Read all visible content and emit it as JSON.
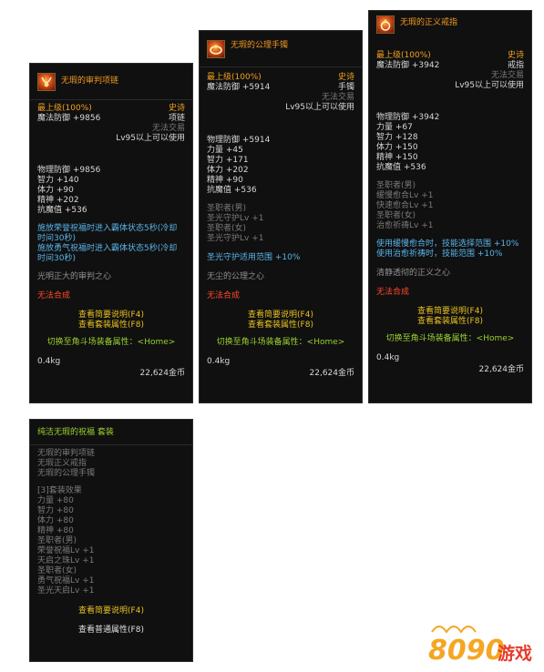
{
  "tooltips": [
    {
      "name": "无瑕的审判项链",
      "level_label": "最上级(100%)",
      "rarity": "史诗",
      "main_stat": "魔法防御 +9856",
      "slot": "项链",
      "trade": "无法交易",
      "level_req": "Lv95以上可以使用",
      "stats": [
        "物理防御 +9856",
        "智力 +140",
        "体力 +90",
        "精神 +202",
        "抗魔值 +536"
      ],
      "effects": [
        "施放荣誉祝福时进入霸体状态5秒(冷却时间30秒)",
        "施放勇气祝福时进入霸体状态5秒(冷却时间30秒)"
      ],
      "flavor": "光明正大的审判之心",
      "craft": "无法合成",
      "link1": "查看简要说明(F4)",
      "link2": "查看套装属性(F8)",
      "switch": "切换至角斗场装备属性：<Home>",
      "weight": "0.4kg",
      "price": "22,624金币"
    },
    {
      "name": "无瑕的公理手镯",
      "level_label": "最上级(100%)",
      "rarity": "史诗",
      "main_stat": "魔法防御 +5914",
      "slot": "手镯",
      "trade": "无法交易",
      "level_req": "Lv95以上可以使用",
      "stats": [
        "物理防御 +5914",
        "力量 +45",
        "智力 +171",
        "体力 +202",
        "精神 +90",
        "抗魔值 +536"
      ],
      "skills": [
        "圣职者(男)",
        "圣光守护Lv +1",
        "圣职者(女)",
        "圣光守护Lv +1"
      ],
      "effects": [
        "圣光守护适用范围 +10%"
      ],
      "flavor": "无尘的公理之心",
      "craft": "无法合成",
      "link1": "查看简要说明(F4)",
      "link2": "查看套装属性(F8)",
      "switch": "切换至角斗场装备属性：<Home>",
      "weight": "0.4kg",
      "price": "22,624金币"
    },
    {
      "name": "无瑕的正义戒指",
      "level_label": "最上级(100%)",
      "rarity": "史诗",
      "main_stat": "魔法防御 +3942",
      "slot": "戒指",
      "trade": "无法交易",
      "level_req": "Lv95以上可以使用",
      "stats": [
        "物理防御 +3942",
        "力量 +67",
        "智力 +128",
        "体力 +150",
        "精神 +150",
        "抗魔值 +536"
      ],
      "skills": [
        "圣职者(男)",
        "缓慢愈合Lv +1",
        "快速愈合Lv +1",
        "圣职者(女)",
        "治愈祈祷Lv +1"
      ],
      "effects": [
        "使用缓慢愈合时，技能选择范围 +10%",
        "使用治愈祈祷时，技能范围 +10%"
      ],
      "flavor": "清静透彻的正义之心",
      "craft": "无法合成",
      "link1": "查看简要说明(F4)",
      "link2": "查看套装属性(F8)",
      "switch": "切换至角斗场装备属性：<Home>",
      "weight": "0.4kg",
      "price": "22,624金币"
    }
  ],
  "set": {
    "title": "纯洁无瑕的祝福  套装",
    "pieces": [
      "无瑕的审判项链",
      "无瑕正义戒指",
      "无瑕的公理手镯"
    ],
    "effect_header": "[3]套装效果",
    "stats": [
      "力量 +80",
      "智力 +80",
      "体力 +80",
      "精神 +80"
    ],
    "skills": [
      "圣职者(男)",
      "荣誉祝福Lv +1",
      "天启之珠Lv +1",
      "圣职者(女)",
      "勇气祝福Lv +1",
      "圣光天启Lv +1"
    ],
    "link1": "查看简要说明(F4)",
    "link2": "查看普通属性(F8)"
  },
  "watermark": {
    "text": "8090游戏",
    "colors": {
      "digits": "#f5a623",
      "text": "#e83a2a"
    }
  },
  "icons": [
    "necklace-icon",
    "bracelet-icon",
    "ring-icon"
  ]
}
